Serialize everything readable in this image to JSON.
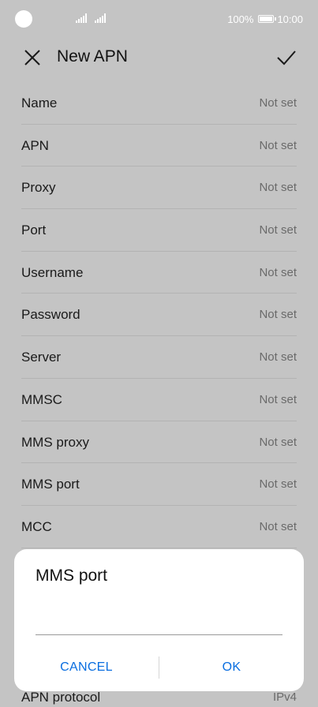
{
  "status_bar": {
    "battery_percent": "100%",
    "time": "10:00",
    "icon_color": "#ffffff"
  },
  "toolbar": {
    "title": "New APN",
    "close_icon": "close-icon",
    "confirm_icon": "check-icon"
  },
  "fields": [
    {
      "label": "Name",
      "value": "Not set"
    },
    {
      "label": "APN",
      "value": "Not set"
    },
    {
      "label": "Proxy",
      "value": "Not set"
    },
    {
      "label": "Port",
      "value": "Not set"
    },
    {
      "label": "Username",
      "value": "Not set"
    },
    {
      "label": "Password",
      "value": "Not set"
    },
    {
      "label": "Server",
      "value": "Not set"
    },
    {
      "label": "MMSC",
      "value": "Not set"
    },
    {
      "label": "MMS proxy",
      "value": "Not set"
    },
    {
      "label": "MMS port",
      "value": "Not set"
    },
    {
      "label": "MCC",
      "value": "Not set"
    }
  ],
  "partial_field": {
    "label": "APN protocol",
    "value": "IPv4"
  },
  "dialog": {
    "title": "MMS port",
    "input_value": "",
    "cancel_label": "CANCEL",
    "ok_label": "OK",
    "accent_color": "#0a6ee0"
  }
}
